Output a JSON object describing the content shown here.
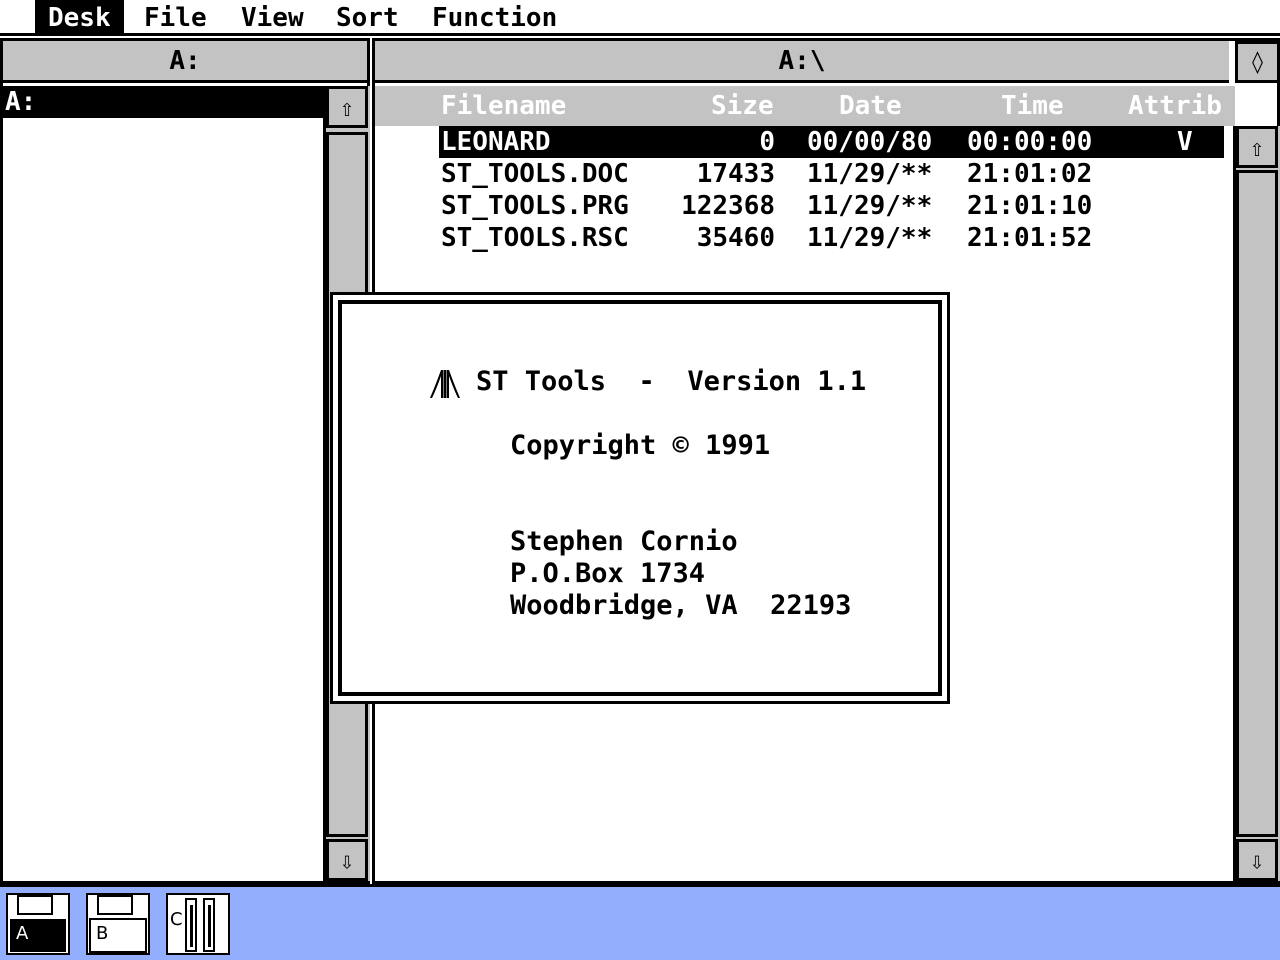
{
  "menu": [
    "Desk",
    "File",
    "View",
    "Sort",
    "Function"
  ],
  "left_window": {
    "title": "A:",
    "tree_items": [
      "A:"
    ],
    "scroll_up_icon": "⇧",
    "scroll_down_icon": "⇩"
  },
  "right_window": {
    "title": "A:\\",
    "fuller_icon": "◊",
    "columns": [
      "Filename",
      "Size",
      "Date",
      "Time",
      "Attrib"
    ],
    "files": [
      {
        "name": "LEONARD",
        "size": "0",
        "date": "00/00/80",
        "time": "00:00:00",
        "attrib": "V"
      },
      {
        "name": "ST_TOOLS.DOC",
        "size": "17433",
        "date": "11/29/**",
        "time": "21:01:02",
        "attrib": ""
      },
      {
        "name": "ST_TOOLS.PRG",
        "size": "122368",
        "date": "11/29/**",
        "time": "21:01:10",
        "attrib": ""
      },
      {
        "name": "ST_TOOLS.RSC",
        "size": "35460",
        "date": "11/29/**",
        "time": "21:01:52",
        "attrib": ""
      }
    ],
    "scroll_up_icon": "⇧",
    "scroll_down_icon": "⇩"
  },
  "dialog": {
    "title": "ST Tools  -  Version 1.1",
    "copyright": "Copyright © 1991",
    "author": "Stephen Cornio",
    "address1": "P.O.Box 1734",
    "address2": "Woodbridge, VA  22193"
  },
  "drives": [
    {
      "label": "A",
      "type": "floppy-icon"
    },
    {
      "label": "B",
      "type": "floppy-icon"
    },
    {
      "label": "C",
      "type": "harddisk-icon"
    }
  ],
  "colors": {
    "desktop": "#92aefc",
    "window_chrome": "#c3c3c3"
  }
}
